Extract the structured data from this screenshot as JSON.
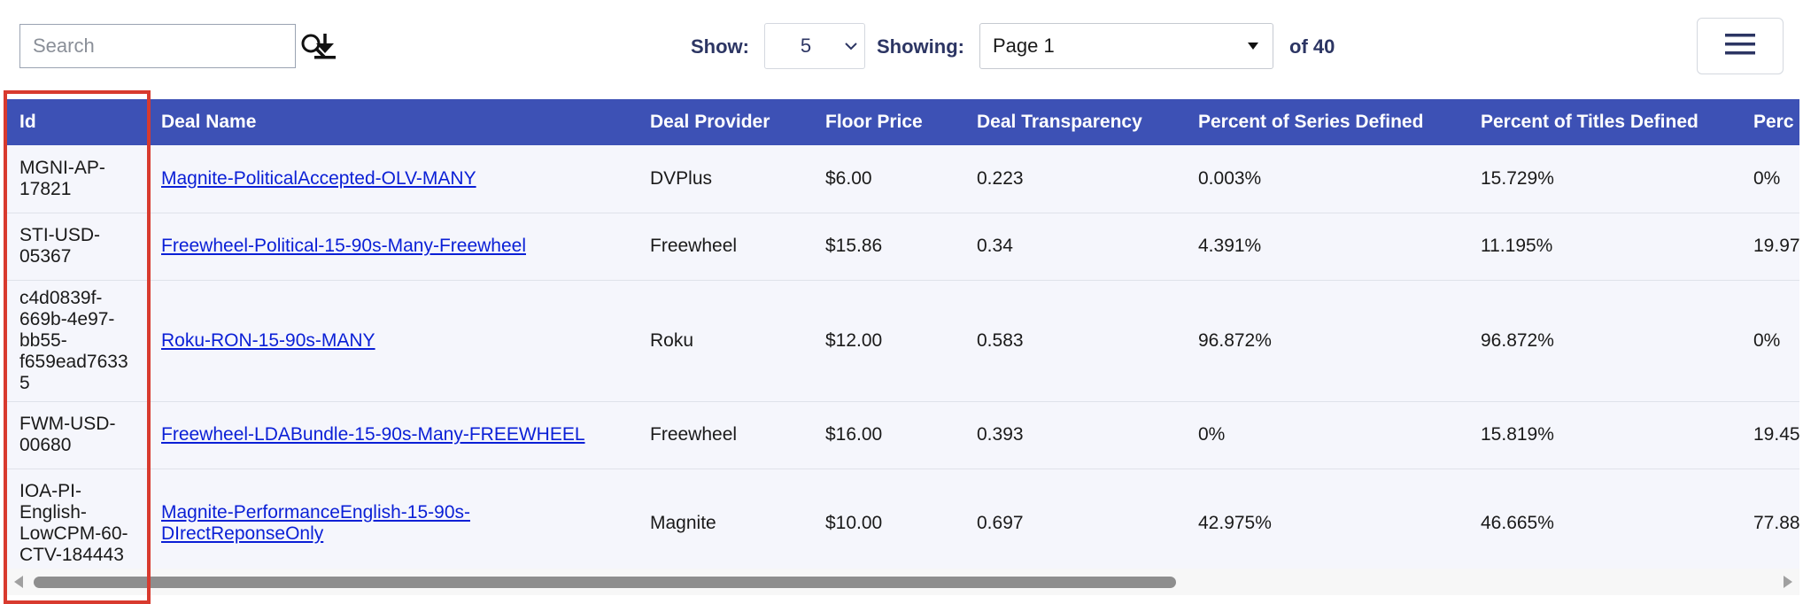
{
  "toolbar": {
    "search_placeholder": "Search",
    "show_label": "Show:",
    "show_value": "5",
    "showing_label": "Showing:",
    "page_value": "Page 1",
    "of_label": "of 40"
  },
  "table": {
    "headers": [
      "Id",
      "Deal Name",
      "Deal Provider",
      "Floor Price",
      "Deal Transparency",
      "Percent of Series Defined",
      "Percent of Titles Defined",
      "Perc"
    ],
    "rows": [
      {
        "id": "MGNI-AP-17821",
        "name": "Magnite-PoliticalAccepted-OLV-MANY",
        "provider": "DVPlus",
        "floor": "$6.00",
        "transparency": "0.223",
        "series": "0.003%",
        "titles": "15.729%",
        "perc": "0%"
      },
      {
        "id": "STI-USD-05367",
        "name": "Freewheel-Political-15-90s-Many-Freewheel",
        "provider": "Freewheel",
        "floor": "$15.86",
        "transparency": "0.34",
        "series": "4.391%",
        "titles": "11.195%",
        "perc": "19.97"
      },
      {
        "id": "c4d0839f-669b-4e97-bb55-f659ead76335",
        "name": "Roku-RON-15-90s-MANY",
        "provider": "Roku",
        "floor": "$12.00",
        "transparency": "0.583",
        "series": "96.872%",
        "titles": "96.872%",
        "perc": "0%"
      },
      {
        "id": "FWM-USD-00680",
        "name": "Freewheel-LDABundle-15-90s-Many-FREEWHEEL",
        "provider": "Freewheel",
        "floor": "$16.00",
        "transparency": "0.393",
        "series": "0%",
        "titles": "15.819%",
        "perc": "19.45"
      },
      {
        "id": "IOA-PI-English-LowCPM-60-CTV-184443",
        "name": "Magnite-PerformanceEnglish-15-90s-DIrectReponseOnly",
        "provider": "Magnite",
        "floor": "$10.00",
        "transparency": "0.697",
        "series": "42.975%",
        "titles": "46.665%",
        "perc": "77.88"
      }
    ]
  },
  "colors": {
    "header_bg": "#3d51b5",
    "row_bg": "#f5f6fc",
    "link": "#0a1fd6",
    "highlight": "#d83a2e",
    "label_text": "#2c3563"
  },
  "icons": [
    "search-icon",
    "download-icon",
    "chevron-down-icon",
    "caret-down-icon",
    "hamburger-menu-icon",
    "scroll-left-icon",
    "scroll-right-icon"
  ]
}
